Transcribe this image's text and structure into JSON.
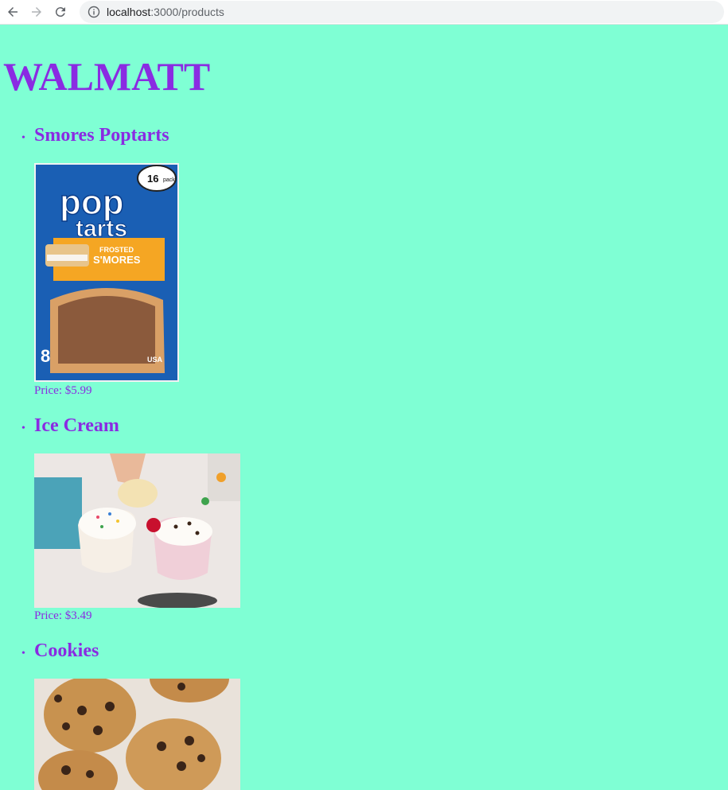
{
  "browser": {
    "url_host": "localhost",
    "url_path": ":3000/products"
  },
  "site": {
    "title": "WALMATT"
  },
  "products": [
    {
      "name": "Smores Poptarts",
      "price": "Price: $5.99",
      "image": "poptarts-box"
    },
    {
      "name": "Ice Cream",
      "price": "Price: $3.49",
      "image": "ice-cream-cups"
    },
    {
      "name": "Cookies",
      "price": "",
      "image": "chocolate-chip-cookies"
    }
  ],
  "colors": {
    "background": "#7fffd4",
    "text": "#8a2be2"
  }
}
